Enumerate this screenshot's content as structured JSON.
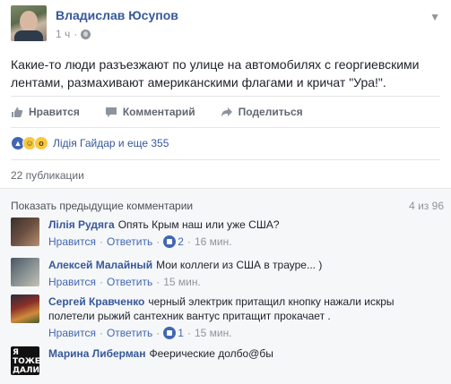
{
  "post": {
    "author": "Владислав Юсупов",
    "time": "1 ч",
    "dot": "·",
    "text": "Какие-то люди разъезжают по улице на автомобилях с георгиевскими лентами, размахивают американскими флагами и кричат \"Ура!\"."
  },
  "actions": {
    "like": "Нравится",
    "comment": "Комментарий",
    "share": "Поделиться"
  },
  "reactions": {
    "text": "Лідія Гайдар и еще 355",
    "icons": [
      "like-icon",
      "haha-icon",
      "wow-icon"
    ]
  },
  "shares": "22 публикации",
  "comments": {
    "show_previous": "Показать предыдущие комментарии",
    "count": "4 из 96",
    "like_label": "Нравится",
    "reply_label": "Ответить",
    "items": [
      {
        "name": "Лілія Рудяга",
        "text": "Опять Крым наш или уже США?",
        "likes": "2",
        "time": "16 мин."
      },
      {
        "name": "Алексей Малайный",
        "text": "Мои коллеги из США в трауре... )",
        "likes": "",
        "time": "15 мин."
      },
      {
        "name": "Сергей Кравченко",
        "text": "черный электрик притащил кнопку нажали искры полетели рыжий сантехник вантус притащит прокачает .",
        "likes": "1",
        "time": "15 мин."
      },
      {
        "name": "Марина Либерман",
        "text": "Феерические долбо@бы",
        "likes": "",
        "time": "",
        "avatar_text": "Я ТОЖЕ ДАЛИН"
      }
    ]
  },
  "colors": {
    "link": "#365899",
    "accent": "#4267b2",
    "muted": "#90949c"
  }
}
